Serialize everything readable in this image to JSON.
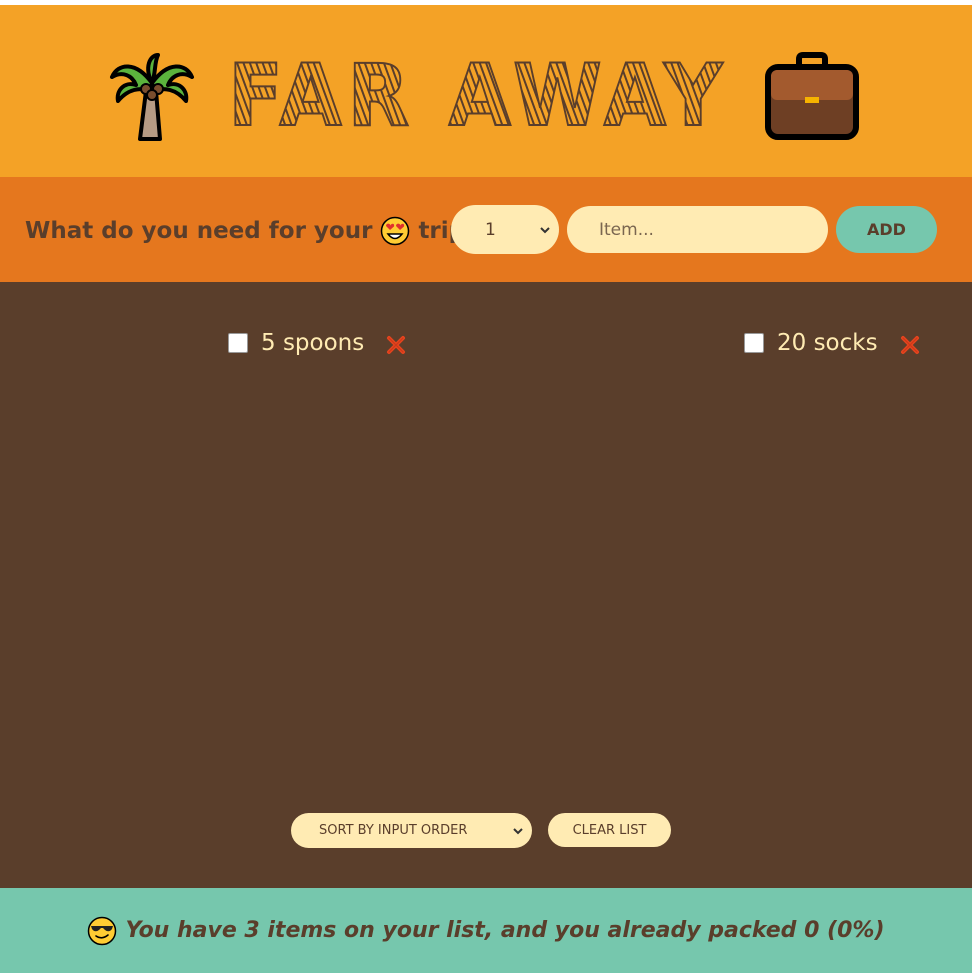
{
  "header": {
    "title": "FAR AWAY",
    "left_icon": "palm-tree-icon",
    "right_icon": "briefcase-icon"
  },
  "form": {
    "question_prefix": "What do you need for your",
    "question_emoji": "heart-eyes-emoji-icon",
    "question_suffix": "trip",
    "quantity_selected": "1",
    "item_placeholder": "Item...",
    "add_label": "ADD"
  },
  "items": [
    {
      "label": "5 spoons",
      "packed": false
    },
    {
      "label": "20 socks",
      "packed": false
    }
  ],
  "actions": {
    "sort_selected": "SORT BY INPUT ORDER",
    "clear_label": "CLEAR LIST"
  },
  "stats": {
    "emoji": "sunglasses-emoji-icon",
    "text": "You have 3 items on your list, and you already packed 0 (0%)"
  },
  "colors": {
    "header_bg": "#f4a226",
    "form_bg": "#e5771e",
    "list_bg": "#5a3e2b",
    "footer_bg": "#76c7ad",
    "pill_bg": "#ffebb3",
    "delete_red": "#e5441e"
  }
}
